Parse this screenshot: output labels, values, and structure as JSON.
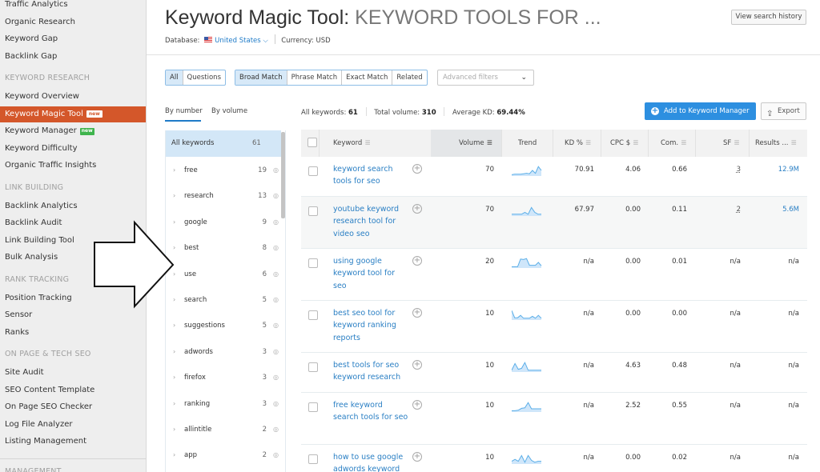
{
  "sidebar": {
    "top_items": [
      "Traffic Analytics",
      "Organic Research",
      "Keyword Gap",
      "Backlink Gap"
    ],
    "sections": [
      {
        "heading": "KEYWORD RESEARCH",
        "items": [
          {
            "label": "Keyword Overview"
          },
          {
            "label": "Keyword Magic Tool",
            "badge": "new",
            "active": true
          },
          {
            "label": "Keyword Manager",
            "badge": "new"
          },
          {
            "label": "Keyword Difficulty"
          },
          {
            "label": "Organic Traffic Insights"
          }
        ]
      },
      {
        "heading": "LINK BUILDING",
        "items": [
          {
            "label": "Backlink Analytics"
          },
          {
            "label": "Backlink Audit"
          },
          {
            "label": "Link Building Tool"
          },
          {
            "label": "Bulk Analysis"
          }
        ]
      },
      {
        "heading": "RANK TRACKING",
        "items": [
          {
            "label": "Position Tracking"
          },
          {
            "label": "Sensor"
          },
          {
            "label": "Ranks"
          }
        ]
      },
      {
        "heading": "ON PAGE & TECH SEO",
        "items": [
          {
            "label": "Site Audit"
          },
          {
            "label": "SEO Content Template"
          },
          {
            "label": "On Page SEO Checker"
          },
          {
            "label": "Log File Analyzer"
          },
          {
            "label": "Listing Management"
          }
        ]
      },
      {
        "heading": "MANAGEMENT",
        "items": []
      }
    ],
    "active_color": "#d4572a",
    "new_badge_color": "#3fb44d"
  },
  "header": {
    "title_prefix": "Keyword Magic Tool:",
    "title_query": "KEYWORD TOOLS FOR ...",
    "view_history_label": "View search history",
    "database_label": "Database:",
    "database_value": "United States",
    "currency_label": "Currency:",
    "currency_value": "USD"
  },
  "filters": {
    "type_tabs": [
      {
        "label": "All",
        "selected": true
      },
      {
        "label": "Questions"
      }
    ],
    "match_tabs": [
      {
        "label": "Broad Match",
        "selected": true
      },
      {
        "label": "Phrase Match"
      },
      {
        "label": "Exact Match"
      },
      {
        "label": "Related"
      }
    ],
    "advanced_placeholder": "Advanced filters"
  },
  "groups": {
    "tabs": [
      {
        "label": "By number",
        "selected": true
      },
      {
        "label": "By volume"
      }
    ],
    "all_label": "All keywords",
    "all_count": "61",
    "items": [
      {
        "name": "free",
        "count": "19"
      },
      {
        "name": "research",
        "count": "13"
      },
      {
        "name": "google",
        "count": "9"
      },
      {
        "name": "best",
        "count": "8"
      },
      {
        "name": "use",
        "count": "6"
      },
      {
        "name": "search",
        "count": "5"
      },
      {
        "name": "suggestions",
        "count": "5"
      },
      {
        "name": "adwords",
        "count": "3"
      },
      {
        "name": "firefox",
        "count": "3"
      },
      {
        "name": "ranking",
        "count": "3"
      },
      {
        "name": "allintitle",
        "count": "2"
      },
      {
        "name": "app",
        "count": "2"
      }
    ]
  },
  "stats": {
    "all_keywords_label": "All keywords:",
    "all_keywords_value": "61",
    "total_volume_label": "Total volume:",
    "total_volume_value": "310",
    "avg_kd_label": "Average KD:",
    "avg_kd_value": "69.44%"
  },
  "actions": {
    "add_to_manager_label": "Add to Keyword Manager",
    "export_label": "Export",
    "accent_color": "#2d8fe0"
  },
  "table": {
    "columns": [
      "Keyword",
      "Volume",
      "Trend",
      "KD %",
      "CPC $",
      "Com.",
      "SF",
      "Results ..."
    ],
    "rows": [
      {
        "keyword": "keyword search tools for seo",
        "volume": "70",
        "kd": "70.91",
        "cpc": "4.06",
        "com": "0.66",
        "sf": "3",
        "results": "12.9M",
        "trend": [
          0.05,
          0.1,
          0.1,
          0.1,
          0.15,
          0.2,
          0.15,
          0.5,
          0.2,
          0.9,
          0.5
        ]
      },
      {
        "keyword": "youtube keyword research tool for video seo",
        "volume": "70",
        "kd": "67.97",
        "cpc": "0.00",
        "com": "0.11",
        "sf": "2",
        "results": "5.6M",
        "trend": [
          0.1,
          0.1,
          0.1,
          0.1,
          0.3,
          0.1,
          0.8,
          0.3,
          0.1,
          0.1
        ]
      },
      {
        "keyword": "using google keyword tool for seo",
        "volume": "20",
        "kd": "n/a",
        "cpc": "0.00",
        "com": "0.01",
        "sf": "n/a",
        "results": "n/a",
        "trend": [
          0.05,
          0.05,
          0.05,
          0.85,
          0.8,
          0.9,
          0.2,
          0.2,
          0.2,
          0.5,
          0.15
        ]
      },
      {
        "keyword": "best seo tool for keyword ranking reports",
        "volume": "10",
        "kd": "n/a",
        "cpc": "0.00",
        "com": "0.00",
        "sf": "n/a",
        "results": "n/a",
        "trend": [
          0.9,
          0.15,
          0.15,
          0.4,
          0.1,
          0.1,
          0.1,
          0.3,
          0.1,
          0.4,
          0.1
        ]
      },
      {
        "keyword": "best tools for seo keyword research",
        "volume": "10",
        "kd": "n/a",
        "cpc": "4.63",
        "com": "0.48",
        "sf": "n/a",
        "results": "n/a",
        "trend": [
          0.1,
          0.8,
          0.2,
          0.3,
          0.9,
          0.1,
          0.1,
          0.1,
          0.1,
          0.1
        ]
      },
      {
        "keyword": "free keyword search tools for seo",
        "volume": "10",
        "kd": "n/a",
        "cpc": "2.52",
        "com": "0.55",
        "sf": "n/a",
        "results": "n/a",
        "trend": [
          0.05,
          0.05,
          0.1,
          0.3,
          0.35,
          0.9,
          0.25,
          0.25,
          0.25,
          0.25
        ]
      },
      {
        "keyword": "how to use google adwords keyword",
        "volume": "10",
        "kd": "n/a",
        "cpc": "0.00",
        "com": "0.02",
        "sf": "n/a",
        "results": "n/a",
        "trend": [
          0.2,
          0.4,
          0.2,
          0.8,
          0.1,
          0.8,
          0.3,
          0.1,
          0.2,
          0.2
        ]
      }
    ]
  },
  "annotation": {
    "type": "arrow",
    "direction": "right"
  }
}
